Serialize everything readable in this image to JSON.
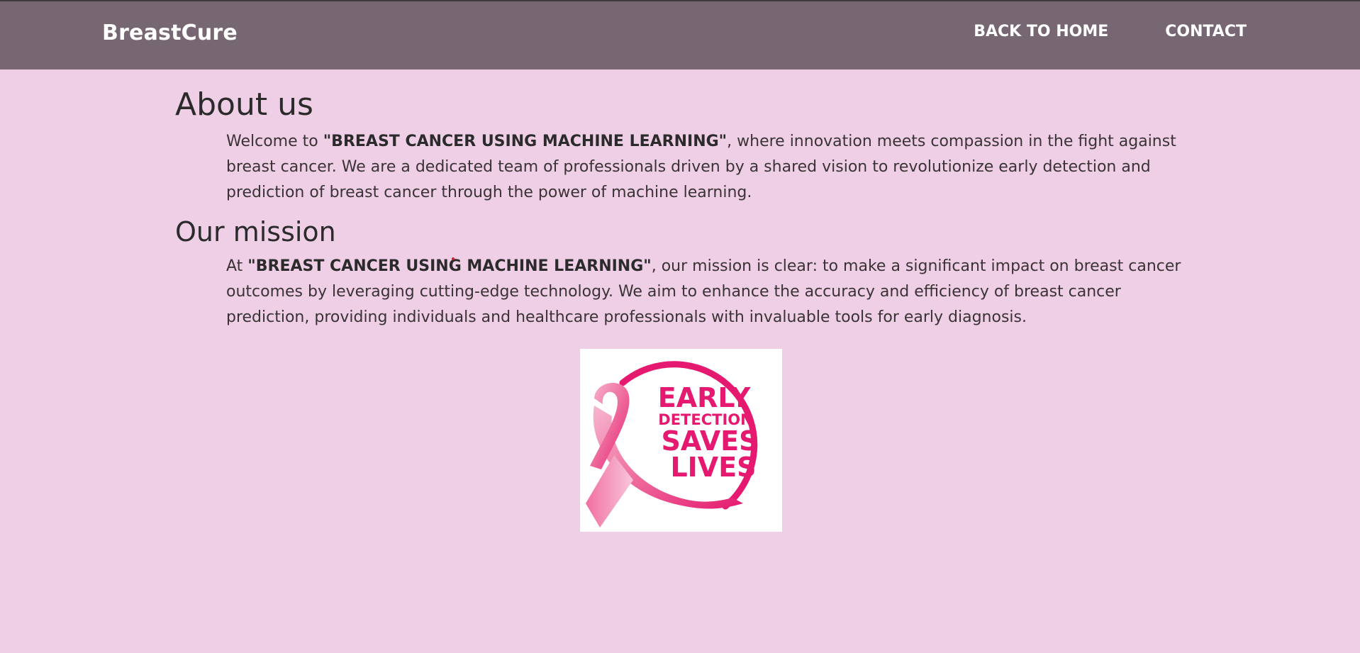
{
  "navbar": {
    "brand": "BreastCure",
    "links": [
      {
        "label": "BACK TO HOME"
      },
      {
        "label": "CONTACT"
      }
    ]
  },
  "about": {
    "title": "About us",
    "text_prefix": "Welcome to ",
    "text_bold": "\"BREAST CANCER USING MACHINE LEARNING\"",
    "text_suffix": ", where innovation meets compassion in the fight against breast cancer. We are a dedicated team of professionals driven by a shared vision to revolutionize early detection and prediction of breast cancer through the power of machine learning."
  },
  "mission": {
    "title": "Our mission",
    "text_prefix": "At ",
    "text_bold": "\"BREAST CANCER USING MACHINE LEARNING\"",
    "text_suffix": ", our mission is clear: to make a significant impact on breast cancer outcomes by leveraging cutting-edge technology. We aim to enhance the accuracy and efficiency of breast cancer prediction, providing individuals and healthcare professionals with invaluable tools for early diagnosis."
  },
  "image": {
    "lines": [
      "EARLY",
      "DETECTION",
      "SAVES",
      "LIVES"
    ],
    "colors": {
      "primary": "#e5196f",
      "ribbon_light": "#f5a3c2",
      "ribbon_mid": "#ee6b9c"
    }
  },
  "colors": {
    "background": "#efcfe5",
    "navbar": "#766773",
    "text": "#2b2b2b"
  }
}
